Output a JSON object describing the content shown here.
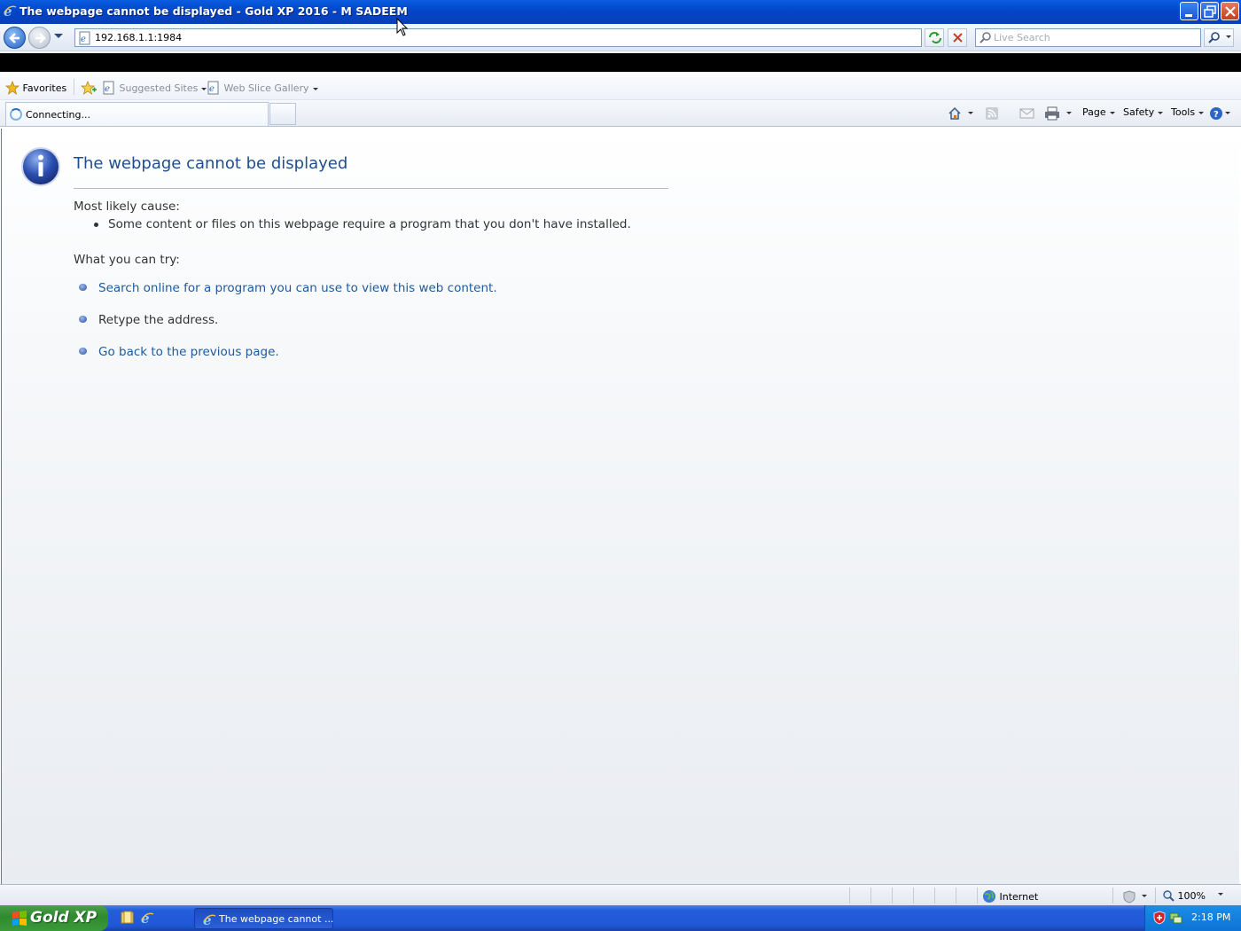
{
  "window": {
    "title": "The webpage cannot be displayed - Gold XP 2016 - M SADEEM"
  },
  "address_bar": {
    "url": "192.168.1.1:1984",
    "search_placeholder": "Live Search"
  },
  "favorites_bar": {
    "favorites_label": "Favorites",
    "items": [
      {
        "label": "Suggested Sites"
      },
      {
        "label": "Web Slice Gallery"
      }
    ]
  },
  "tabs": [
    {
      "label": "Connecting..."
    }
  ],
  "command_bar": {
    "page_label": "Page",
    "safety_label": "Safety",
    "tools_label": "Tools"
  },
  "content": {
    "heading": "The webpage cannot be displayed",
    "cause_label": "Most likely cause:",
    "causes": [
      "Some content or files on this webpage require a program that you don't have installed."
    ],
    "try_label": "What you can try:",
    "suggestions": [
      {
        "text": "Search online for a program you can use to view this web content.",
        "is_link": true
      },
      {
        "text": "Retype the address.",
        "is_link": false
      },
      {
        "text": "Go back to the previous page.",
        "is_link": true
      }
    ]
  },
  "status_bar": {
    "zone": "Internet",
    "zoom": "100%"
  },
  "taskbar": {
    "start_label": "Gold XP",
    "task_label": "The webpage cannot ...",
    "clock": "2:18 PM"
  },
  "colors": {
    "link": "#1e5a9c",
    "heading": "#1f4e8c",
    "titlebar": "#0246c8",
    "taskbar": "#245edb",
    "start_button": "#2f8a2f"
  },
  "icons": [
    "ie-icon",
    "minimize-icon",
    "restore-icon",
    "close-icon",
    "back-arrow-icon",
    "forward-arrow-icon",
    "page-icon",
    "refresh-icon",
    "stop-icon",
    "search-icon",
    "star-icon",
    "add-favorite-icon",
    "home-icon",
    "rss-icon",
    "mail-icon",
    "print-icon",
    "help-icon",
    "info-icon",
    "globe-icon",
    "zoom-icon",
    "loading-spinner-icon",
    "folder-icon",
    "shield-icon"
  ]
}
